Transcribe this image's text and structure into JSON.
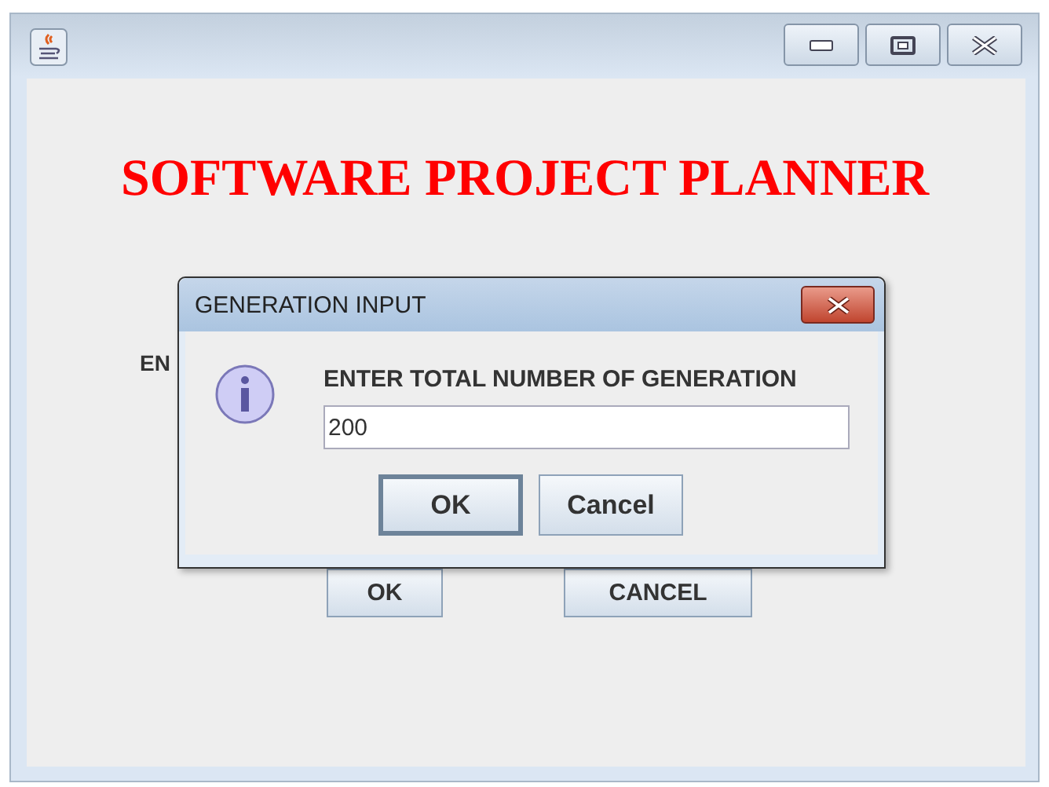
{
  "main": {
    "heading": "SOFTWARE PROJECT PLANNER",
    "label": "EN",
    "buttons": [
      "OK",
      "CANCEL"
    ]
  },
  "dialog": {
    "title": "GENERATION INPUT",
    "message": "ENTER TOTAL NUMBER OF GENERATION",
    "value": "200",
    "buttons": [
      {
        "label": "OK",
        "selected": true
      },
      {
        "label": "Cancel",
        "selected": false
      }
    ]
  }
}
